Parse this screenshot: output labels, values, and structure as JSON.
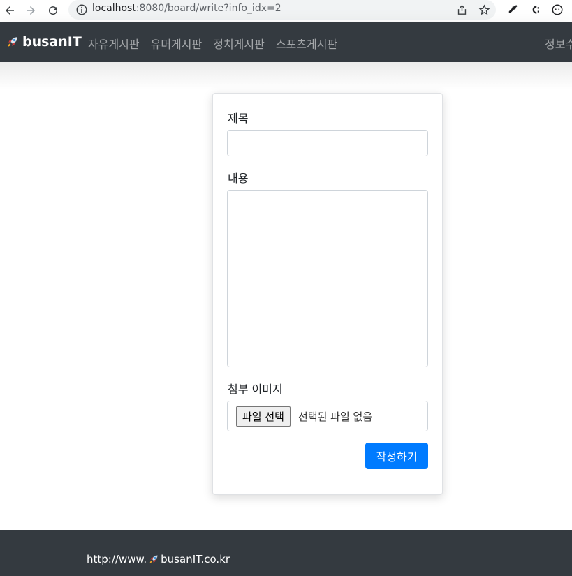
{
  "browser": {
    "url_host": "localhost",
    "url_path": ":8080/board/write?info_idx=2"
  },
  "navbar": {
    "brand": "busanIT",
    "menu": [
      "자유게시판",
      "유머게시판",
      "정치게시판",
      "스포츠게시판"
    ],
    "right_item": "정보수"
  },
  "form": {
    "title_label": "제목",
    "title_value": "",
    "content_label": "내용",
    "content_value": "",
    "image_label": "첨부 이미지",
    "file_button": "파일 선택",
    "file_status": "선택된 파일 없음",
    "submit_label": "작성하기"
  },
  "footer": {
    "prefix": "http://www.",
    "suffix": "busanIT.co.kr"
  },
  "colors": {
    "navbar": "#343a40",
    "primary": "#007bff"
  }
}
